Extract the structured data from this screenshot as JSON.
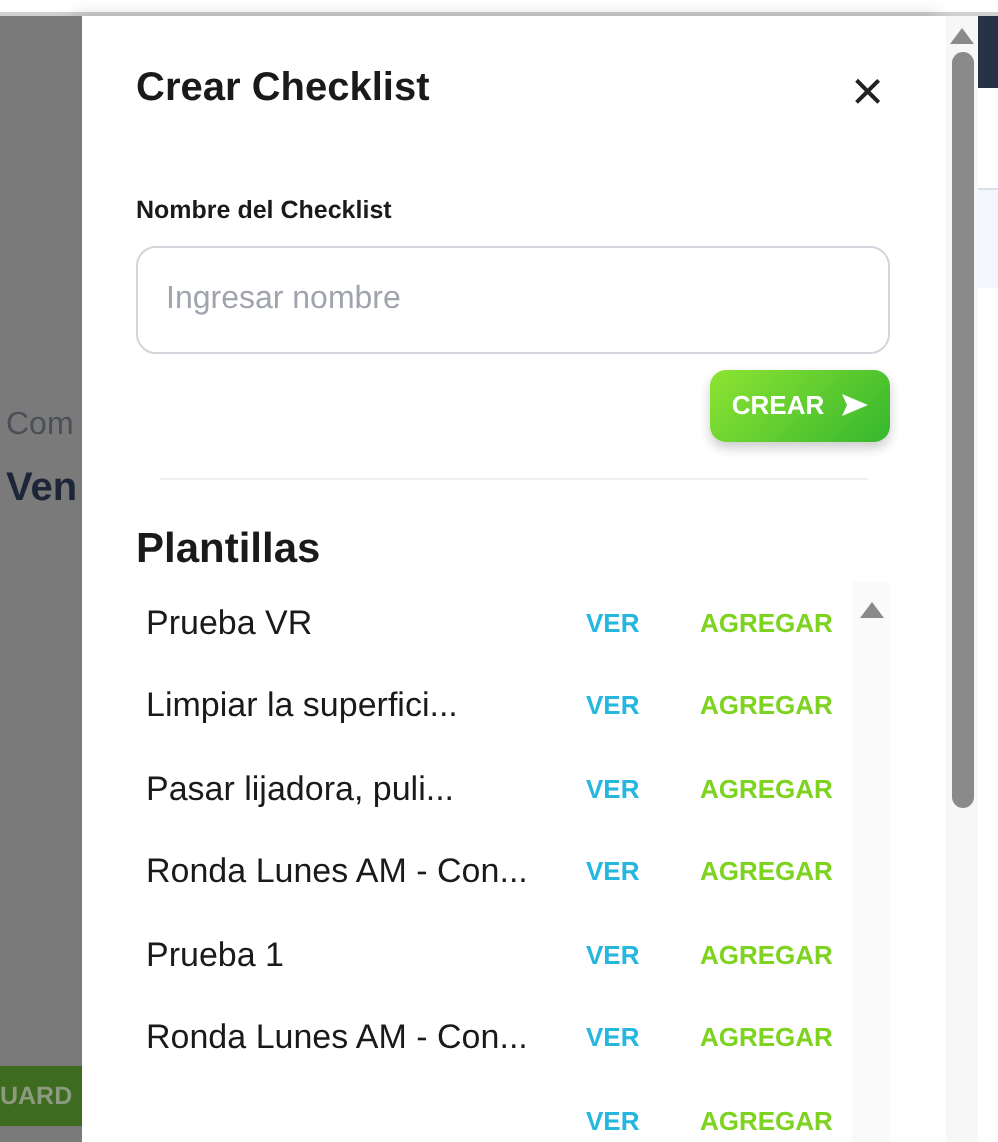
{
  "background": {
    "texts": [
      "Com",
      "Ven"
    ],
    "button": "UARD"
  },
  "dialog": {
    "title": "Crear Checklist",
    "close": "×",
    "name_field": {
      "label": "Nombre del Checklist",
      "placeholder": "Ingresar nombre"
    },
    "create_button": "CREAR"
  },
  "templates": {
    "title": "Plantillas",
    "items": [
      {
        "name": "Prueba VR",
        "view": "VER",
        "add": "AGREGAR"
      },
      {
        "name": "Limpiar la superfici...",
        "view": "VER",
        "add": "AGREGAR"
      },
      {
        "name": "Pasar lijadora, puli...",
        "view": "VER",
        "add": "AGREGAR"
      },
      {
        "name": "Ronda Lunes AM - Con...",
        "view": "VER",
        "add": "AGREGAR"
      },
      {
        "name": "Prueba 1",
        "view": "VER",
        "add": "AGREGAR"
      },
      {
        "name": "Ronda Lunes AM - Con...",
        "view": "VER",
        "add": "AGREGAR"
      },
      {
        "view": "VER",
        "add": "AGREGAR"
      }
    ]
  }
}
